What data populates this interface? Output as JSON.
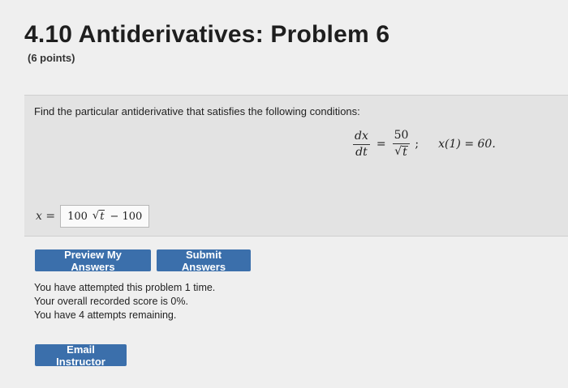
{
  "header": {
    "title": "4.10 Antiderivatives: Problem 6",
    "points": "(6 points)"
  },
  "problem": {
    "prompt": "Find the particular antiderivative that satisfies the following conditions:",
    "equation": {
      "lhs_num": "dx",
      "lhs_den": "dt",
      "equals": "=",
      "rhs_num": "50",
      "rhs_den_radical": "t",
      "separator": ";",
      "condition": "x(1) = 60."
    },
    "answer_label": "x =",
    "answer_parts": {
      "coefficient": "100",
      "radicand": "t",
      "tail": "− 100"
    }
  },
  "buttons": {
    "preview": "Preview My Answers",
    "submit": "Submit Answers",
    "email": "Email Instructor"
  },
  "status": {
    "line1": "You have attempted this problem 1 time.",
    "line2": "Your overall recorded score is 0%.",
    "line3": "You have 4 attempts remaining."
  },
  "colors": {
    "button_bg": "#3b6fab",
    "page_bg": "#efefef",
    "problem_bg": "#e3e3e3"
  }
}
